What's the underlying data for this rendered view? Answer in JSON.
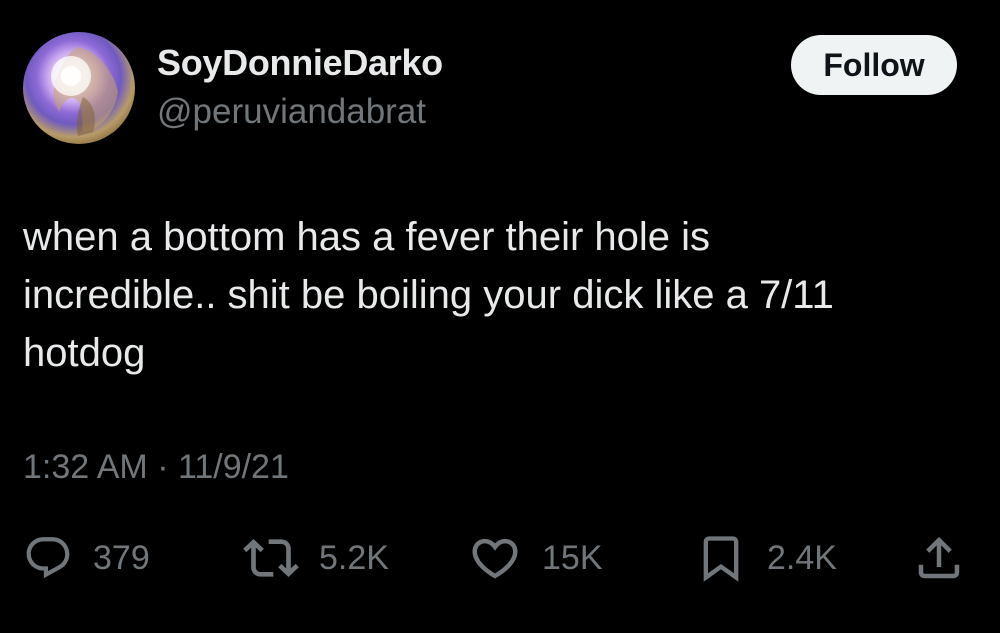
{
  "user": {
    "display_name": "SoyDonnieDarko",
    "handle": "@peruviandabrat"
  },
  "follow_label": "Follow",
  "tweet": {
    "lines": [
      "when a bottom has a fever their hole is",
      "incredible.. shit be boiling your dick like a 7/11",
      "hotdog"
    ],
    "timestamp": "1:32 AM · 11/9/21"
  },
  "actions": {
    "replies": "379",
    "retweets": "5.2K",
    "likes": "15K",
    "bookmarks": "2.4K"
  },
  "icons": {
    "reply": "reply-icon",
    "retweet": "retweet-icon",
    "like": "heart-icon",
    "bookmark": "bookmark-icon",
    "share": "share-icon"
  },
  "colors": {
    "background": "#000000",
    "primary_text": "#e7e9ea",
    "secondary_text": "#71767b",
    "follow_button_bg": "#eff3f4",
    "follow_button_text": "#0f1419"
  }
}
